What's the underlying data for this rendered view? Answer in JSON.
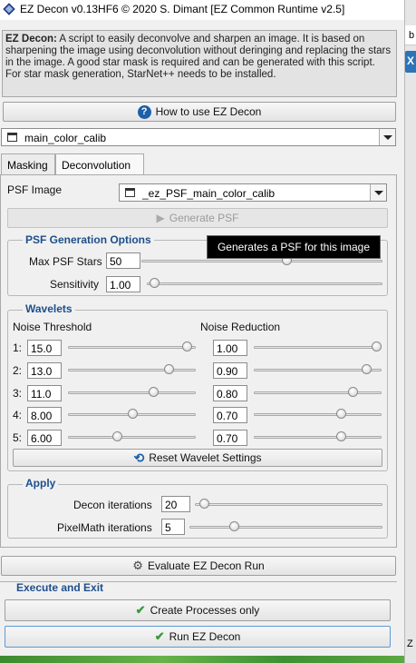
{
  "window": {
    "title": "EZ Decon v0.13HF6 © 2020 S. Dimant [EZ Common Runtime v2.5]"
  },
  "right_edge": {
    "top_char": "b",
    "close_char": "X",
    "bottom_char": "Z"
  },
  "description": {
    "bold": "EZ Decon:",
    "text": " A script to easily deconvolve and sharpen an image. It is based on sharpening the image using deconvolution without deringing and replacing the stars in the image. A good star mask is required and can be generated with this script. For star mask generation, StarNet++ needs to be installed."
  },
  "how_to_button": {
    "label": "How to use EZ Decon",
    "icon": "question-circle-icon"
  },
  "image_combo": {
    "value": "main_color_calib"
  },
  "tabs": [
    {
      "label": "Masking",
      "active": false
    },
    {
      "label": "Deconvolution",
      "active": true
    }
  ],
  "deconvolution": {
    "psf_image_label": "PSF Image",
    "psf_image_value": "_ez_PSF_main_color_calib",
    "generate_psf_label": "Generate PSF",
    "tooltip": "Generates a PSF for this image",
    "psf_options": {
      "title": "PSF Generation Options",
      "max_stars_label": "Max PSF Stars",
      "max_stars_value": "50",
      "max_stars_level": 0.6,
      "sensitivity_label": "Sensitivity",
      "sensitivity_value": "1.00",
      "sensitivity_level": 0.03
    },
    "wavelets": {
      "title": "Wavelets",
      "noise_threshold_label": "Noise Threshold",
      "noise_reduction_label": "Noise Reduction",
      "rows": [
        {
          "label": "1:",
          "threshold": "15.0",
          "threshold_level": 0.93,
          "reduction": "1.00",
          "reduction_level": 1.0
        },
        {
          "label": "2:",
          "threshold": "13.0",
          "threshold_level": 0.79,
          "reduction": "0.90",
          "reduction_level": 0.88
        },
        {
          "label": "3:",
          "threshold": "11.0",
          "threshold_level": 0.67,
          "reduction": "0.80",
          "reduction_level": 0.77
        },
        {
          "label": "4:",
          "threshold": "8.00",
          "threshold_level": 0.5,
          "reduction": "0.70",
          "reduction_level": 0.68
        },
        {
          "label": "5:",
          "threshold": "6.00",
          "threshold_level": 0.38,
          "reduction": "0.70",
          "reduction_level": 0.68
        }
      ],
      "reset_label": "Reset Wavelet Settings"
    },
    "apply": {
      "title": "Apply",
      "decon_iterations_label": "Decon iterations",
      "decon_iterations_value": "20",
      "decon_iterations_level": 0.05,
      "pixelmath_iterations_label": "PixelMath iterations",
      "pixelmath_iterations_value": "5",
      "pixelmath_iterations_level": 0.23
    }
  },
  "evaluate_button": {
    "label": "Evaluate EZ Decon Run"
  },
  "execute": {
    "title": "Execute and Exit",
    "create_processes_label": "Create Processes only",
    "run_label": "Run EZ Decon"
  },
  "colors": {
    "accent_blue": "#1d4f8c",
    "check_green": "#3a9a3a"
  }
}
